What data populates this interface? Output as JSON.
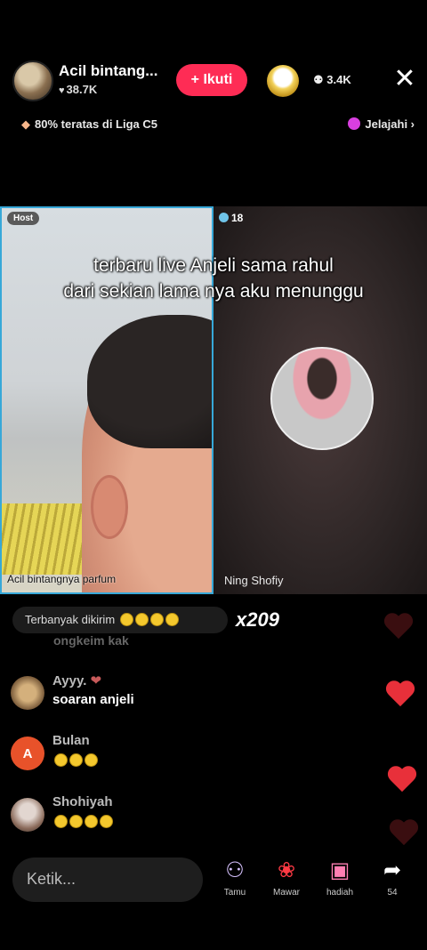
{
  "header": {
    "host_name": "Acil bintang...",
    "host_likes": "38.7K",
    "follow_label": "+ Ikuti",
    "viewer_count": "3.4K",
    "close_label": "✕"
  },
  "league": {
    "rank_text": "80% teratas di Liga C5",
    "explore_label": "Jelajahi ›"
  },
  "videos": {
    "host_tag": "Host",
    "host_label": "Acil bintangnya parfum",
    "guest_count": "18",
    "guest_name": "Ning Shofiy"
  },
  "overlay_caption": {
    "line1": "terbaru live Anjeli sama rahul",
    "line2": "dari sekian lama nya aku menunggu"
  },
  "gifts": {
    "top_label": "Terbanyak dikirim",
    "count": "x209"
  },
  "faded_comment": "ongkeim kak",
  "comments": [
    {
      "name": "Ayyy.",
      "text": "soaran anjeli",
      "avatar_letter": ""
    },
    {
      "name": "Bulan",
      "text": "",
      "avatar_letter": "A"
    },
    {
      "name": "Shohiyah",
      "text": "",
      "avatar_letter": ""
    }
  ],
  "bottom": {
    "input_placeholder": "Ketik...",
    "actions": [
      {
        "label": "Tamu",
        "icon": "people-icon"
      },
      {
        "label": "Mawar",
        "icon": "rose-icon"
      },
      {
        "label": "hadiah",
        "icon": "gift-icon"
      },
      {
        "label": "54",
        "icon": "share-icon"
      }
    ]
  },
  "colors": {
    "follow": "#fe2c55",
    "host_border": "#37a8d8",
    "heart": "#e8303a"
  }
}
